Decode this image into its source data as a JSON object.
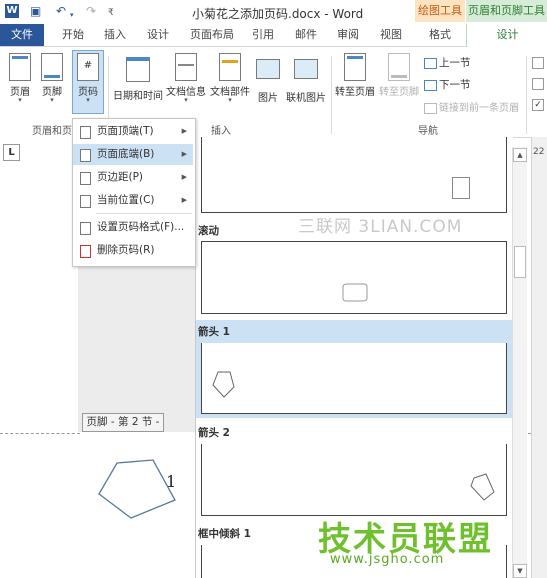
{
  "window": {
    "title": "小菊花之添加页码.docx - Word",
    "context_tab_groups": [
      "绘图工具",
      "页眉和页脚工具"
    ],
    "quick_access_icons": [
      "save-icon",
      "undo-icon",
      "redo-icon"
    ]
  },
  "tabs": [
    "文件",
    "开始",
    "插入",
    "设计",
    "页面布局",
    "引用",
    "邮件",
    "审阅",
    "视图",
    "格式",
    "设计"
  ],
  "ribbon": {
    "buttons": {
      "header": "页眉",
      "footer": "页脚",
      "page_number": "页码",
      "date_time": "日期和时间",
      "doc_info": "文档信息",
      "doc_parts": "文档部件",
      "picture": "图片",
      "online_picture": "联机图片",
      "goto_header": "转至页眉",
      "goto_footer": "转至页脚"
    },
    "nav": {
      "prev": "上一节",
      "next": "下一节",
      "link_prev": "链接到前一条页眉"
    },
    "groups": {
      "header_footer": "页眉和页",
      "insert": "插入",
      "navigation": "导航"
    }
  },
  "page_number_menu": [
    {
      "label": "页面顶端(T)",
      "has_submenu": true
    },
    {
      "label": "页面底端(B)",
      "has_submenu": true,
      "highlighted": true
    },
    {
      "label": "页边距(P)",
      "has_submenu": true
    },
    {
      "label": "当前位置(C)",
      "has_submenu": true
    },
    {
      "label": "设置页码格式(F)...",
      "has_submenu": false
    },
    {
      "label": "删除页码(R)",
      "has_submenu": false
    }
  ],
  "gallery": {
    "items": [
      "滚动",
      "箭头 1",
      "箭头 2",
      "框中倾斜 1"
    ],
    "selected": "箭头 1"
  },
  "document": {
    "tab_stop": "L",
    "footer_tag": "页脚 - 第 2 节 -",
    "page_number_value": "1",
    "ruler_value": "22"
  },
  "watermarks": {
    "top": "三联网 3LIAN.COM",
    "brand": "技术员联盟",
    "url": "www.jsgho.com"
  },
  "colors": {
    "word_blue": "#2b579a",
    "highlight": "#cde1f5",
    "drawing_tools": "#c55a11",
    "hf_tools": "#2e7d32",
    "watermark_green": "#6ec02c"
  }
}
